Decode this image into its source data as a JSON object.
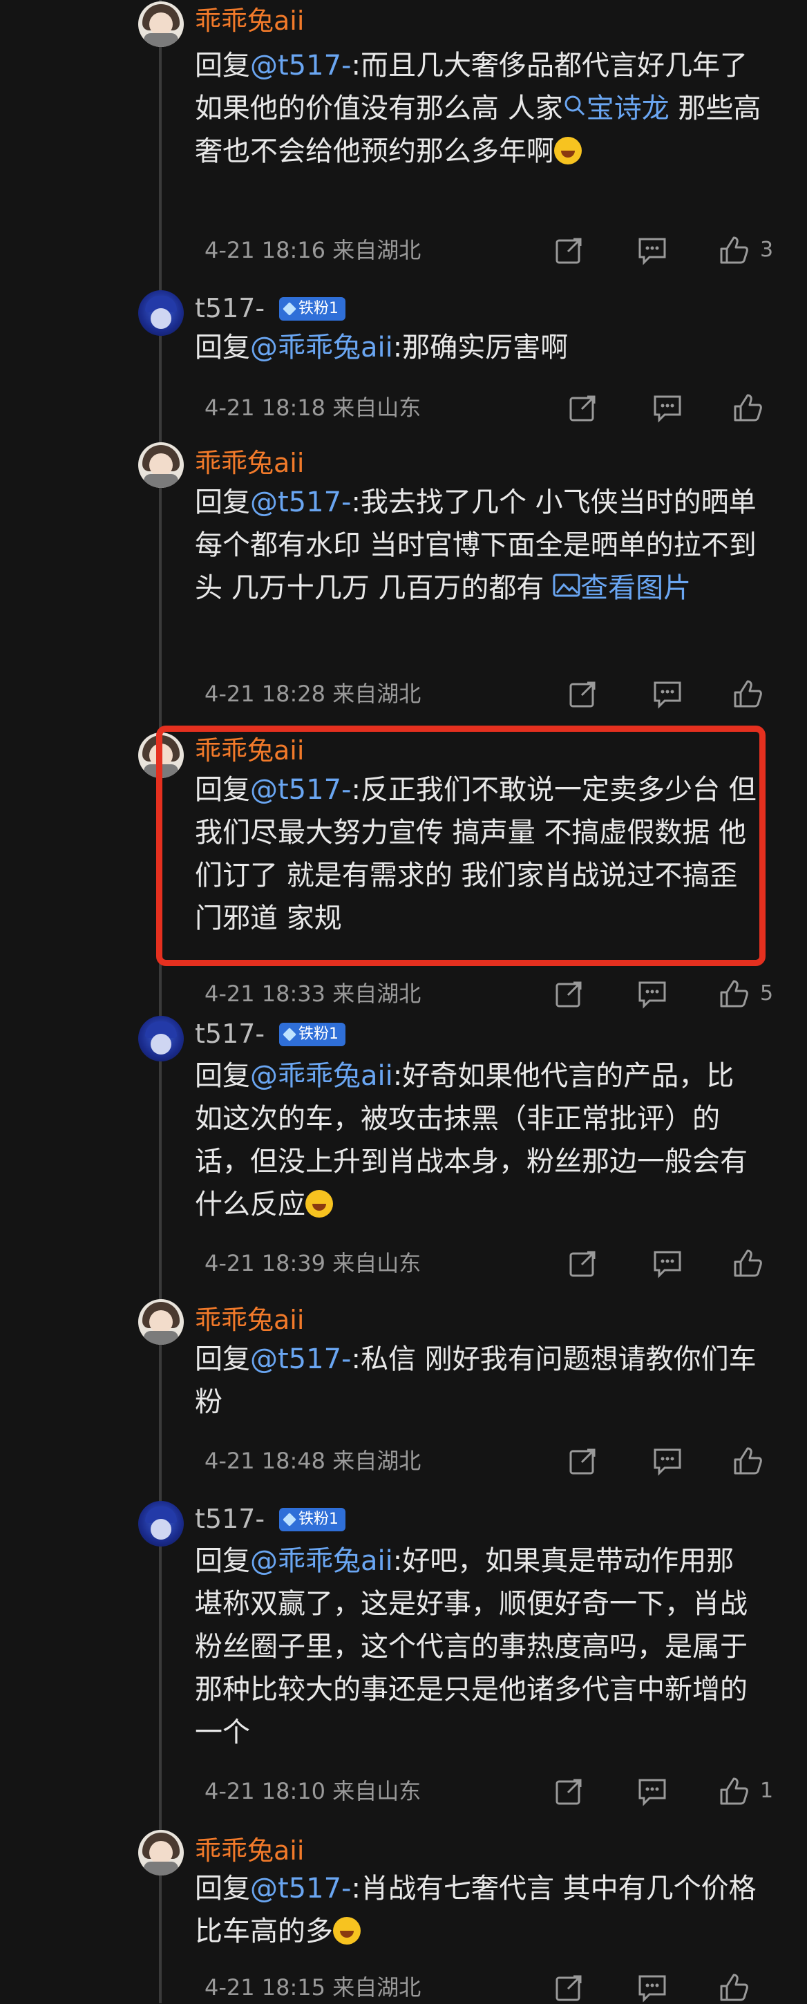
{
  "comments": [
    {
      "user": "乖乖兔aii",
      "reply_prefix": "回复",
      "mention": "@t517-",
      "body_a": ":而且几大奢侈品都代言好几年了 如果他的价值没有那么高 人家",
      "link_text": "宝诗龙",
      "body_b": " 那些高奢也不会给他预约那么多年啊",
      "meta": "4-21 18:16 来自湖北",
      "likes": "3"
    },
    {
      "user": "t517-",
      "badge": "铁粉1",
      "reply_prefix": "回复",
      "mention": "@乖乖兔aii",
      "body": ":那确实厉害啊",
      "meta": "4-21 18:18 来自山东"
    },
    {
      "user": "乖乖兔aii",
      "reply_prefix": "回复",
      "mention": "@t517-",
      "body": ":我去找了几个 小飞侠当时的晒单 每个都有水印 当时官博下面全是晒单的拉不到头 几万十几万 几百万的都有 ",
      "image_link": "查看图片",
      "meta": "4-21 18:28 来自湖北"
    },
    {
      "user": "乖乖兔aii",
      "reply_prefix": "回复",
      "mention": "@t517-",
      "body": ":反正我们不敢说一定卖多少台 但我们尽最大努力宣传 搞声量 不搞虚假数据 他们订了 就是有需求的 我们家肖战说过不搞歪门邪道 家规",
      "meta": "4-21 18:33 来自湖北",
      "likes": "5"
    },
    {
      "user": "t517-",
      "badge": "铁粉1",
      "reply_prefix": "回复",
      "mention": "@乖乖兔aii",
      "body": ":好奇如果他代言的产品，比如这次的车，被攻击抹黑（非正常批评）的话，但没上升到肖战本身，粉丝那边一般会有什么反应",
      "meta": "4-21 18:39 来自山东"
    },
    {
      "user": "乖乖兔aii",
      "reply_prefix": "回复",
      "mention": "@t517-",
      "body": ":私信 刚好我有问题想请教你们车粉",
      "meta": "4-21 18:48 来自湖北"
    },
    {
      "user": "t517-",
      "badge": "铁粉1",
      "reply_prefix": "回复",
      "mention": "@乖乖兔aii",
      "body": ":好吧，如果真是带动作用那堪称双赢了，这是好事，顺便好奇一下，肖战粉丝圈子里，这个代言的事热度高吗，是属于那种比较大的事还是只是他诸多代言中新增的一个",
      "meta": "4-21 18:10 来自山东",
      "likes": "1"
    },
    {
      "user": "乖乖兔aii",
      "reply_prefix": "回复",
      "mention": "@t517-",
      "body": ":肖战有七奢代言 其中有几个价格比车高的多",
      "meta": "4-21 18:15 来自湖北"
    }
  ]
}
